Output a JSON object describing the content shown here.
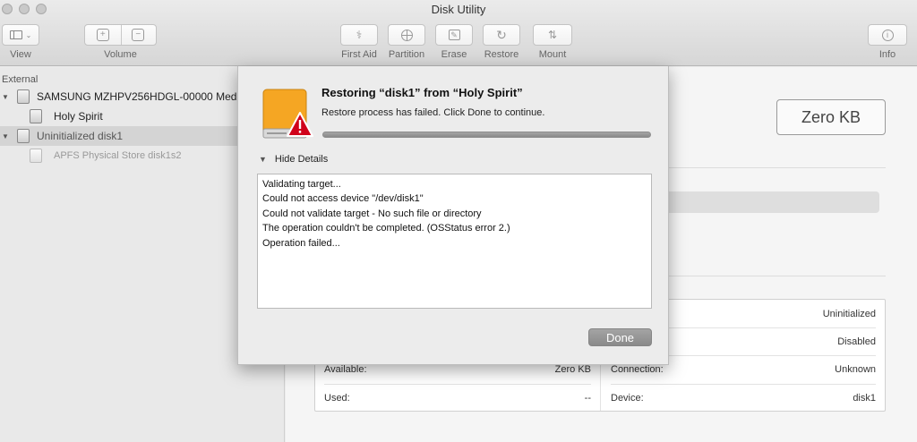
{
  "window": {
    "title": "Disk Utility"
  },
  "toolbar": {
    "view_label": "View",
    "volume_label": "Volume",
    "first_aid_label": "First Aid",
    "partition_label": "Partition",
    "erase_label": "Erase",
    "restore_label": "Restore",
    "mount_label": "Mount",
    "info_label": "Info"
  },
  "sidebar": {
    "section": "External",
    "items": [
      {
        "label": "SAMSUNG MZHPV256HDGL-00000 Med"
      },
      {
        "label": "Holy Spirit"
      },
      {
        "label": "Uninitialized disk1"
      },
      {
        "label": "APFS Physical Store disk1s2"
      }
    ]
  },
  "main": {
    "size": "Zero KB",
    "info": {
      "row1_right_value": "Uninitialized",
      "row2_right_value": "Disabled",
      "available_label": "Available:",
      "available_value": "Zero KB",
      "connection_label": "Connection:",
      "connection_value": "Unknown",
      "used_label": "Used:",
      "used_value": "--",
      "device_label": "Device:",
      "device_value": "disk1"
    }
  },
  "dialog": {
    "title": "Restoring “disk1” from “Holy Spirit”",
    "message": "Restore process has failed. Click Done to continue.",
    "progress": 1.0,
    "details_toggle": "Hide Details",
    "log": [
      "Validating target...",
      "Could not access device \"/dev/disk1\"",
      "Could not validate target - No such file or directory",
      "The operation couldn't be completed. (OSStatus error 2.)",
      "Operation failed..."
    ],
    "done_label": "Done"
  },
  "colors": {
    "alert_red": "#d0021b",
    "drive_orange": "#f5a623"
  }
}
